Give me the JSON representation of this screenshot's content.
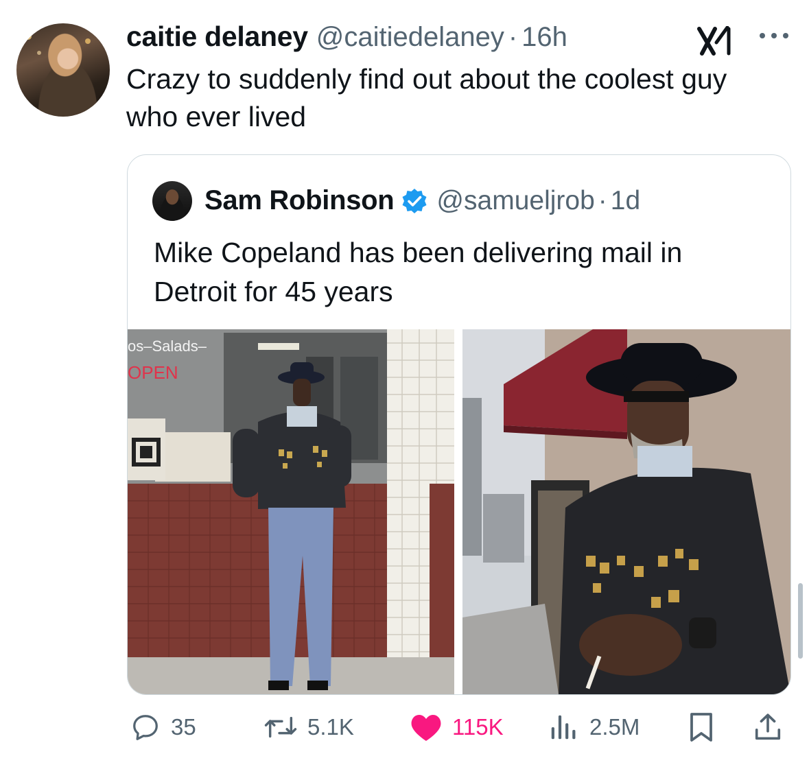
{
  "post": {
    "author_name": "caitie delaney",
    "author_handle": "@caitiedelaney",
    "separator": "·",
    "time": "16h",
    "text": "Crazy to suddenly find out about the coolest guy who ever lived",
    "avatar_icon": "user-avatar-photo"
  },
  "quoted_post": {
    "author_name": "Sam Robinson",
    "verified": true,
    "author_handle": "@samueljrob",
    "separator": "·",
    "time": "1d",
    "text": "Mike Copeland has been delivering mail in Detroit for 45 years",
    "photos": [
      {
        "name": "mail-carrier-photo-left",
        "sign_text": "os–Salads–",
        "open_sign": "OPEN"
      },
      {
        "name": "mail-carrier-photo-right"
      }
    ]
  },
  "actions": {
    "replies": "35",
    "reposts": "5.1K",
    "likes": "115K",
    "views": "2.5M",
    "liked": true
  },
  "colors": {
    "text": "#0f1419",
    "secondary": "#536471",
    "like": "#f91880",
    "verified": "#1d9bf0",
    "border": "#cfd9de"
  }
}
